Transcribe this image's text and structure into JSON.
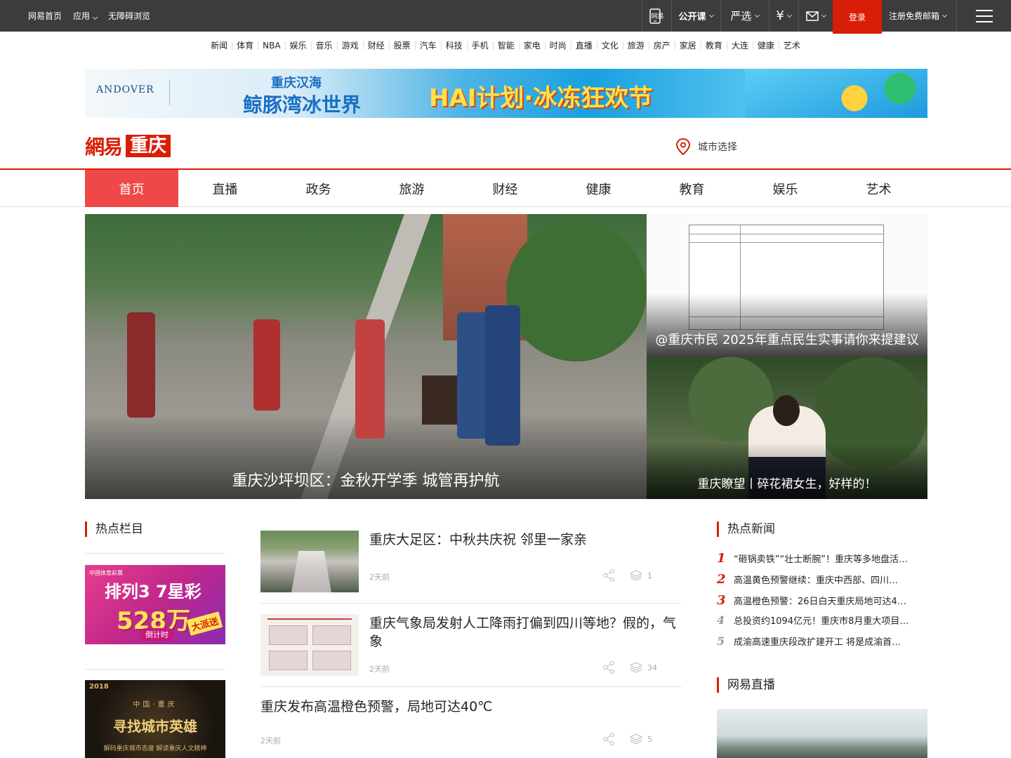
{
  "topbar": {
    "left_links": [
      "网易首页",
      "应用",
      "无障碍浏览"
    ],
    "phone_label": "网易",
    "open_course": "公开课",
    "yanxuan": "严选",
    "login": "登录",
    "register_mail": "注册免费邮箱"
  },
  "channels": [
    "新闻",
    "体育",
    "NBA",
    "娱乐",
    "音乐",
    "游戏",
    "财经",
    "股票",
    "汽车",
    "科技",
    "手机",
    "智能",
    "家电",
    "时尚",
    "直播",
    "文化",
    "旅游",
    "房产",
    "家居",
    "教育",
    "大连",
    "健康",
    "艺术"
  ],
  "banner": {
    "brand": "ANDOVER",
    "park_line1": "重庆汉海",
    "park_line2": "鲸豚湾冰世界",
    "slogan": "HAI计划·冰冻狂欢节"
  },
  "site": {
    "logo_text": "網易",
    "city_name": "重庆",
    "city_select": "城市选择"
  },
  "nav": [
    {
      "label": "首页",
      "active": true
    },
    {
      "label": "直播",
      "active": false
    },
    {
      "label": "政务",
      "active": false
    },
    {
      "label": "旅游",
      "active": false
    },
    {
      "label": "财经",
      "active": false
    },
    {
      "label": "健康",
      "active": false
    },
    {
      "label": "教育",
      "active": false
    },
    {
      "label": "娱乐",
      "active": false
    },
    {
      "label": "艺术",
      "active": false
    }
  ],
  "hero": {
    "main_caption": "重庆沙坪坝区：金秋开学季 城管再护航",
    "side1_caption": "@重庆市民 2025年重点民生实事请你来提建议",
    "side2_caption": "重庆瞭望丨碎花裙女生，好样的！"
  },
  "left_col": {
    "title": "热点栏目",
    "promo1": {
      "a": "排列3 7星彩",
      "b": "528万",
      "c": "倒计时",
      "d": "大派送",
      "e": "中国体育彩票"
    },
    "promo2": {
      "year": "2018",
      "top": "中国·重庆",
      "main": "寻找城市英雄",
      "sub": "解码重庆城市态度  解读重庆人文精神"
    }
  },
  "news": [
    {
      "title": "重庆大足区：中秋共庆祝 邻里一家亲",
      "time": "2天前",
      "comments": "1"
    },
    {
      "title": "重庆气象局发射人工降雨打偏到四川等地？假的，气象",
      "time": "2天前",
      "comments": "34"
    },
    {
      "title": "重庆发布高温橙色预警，局地可达40℃",
      "time": "2天前",
      "comments": "5"
    }
  ],
  "hot_news": {
    "title": "热点新闻",
    "items": [
      "“砸锅卖铁”“壮士断腕”！重庆等多地盘活…",
      "高温黄色预警继续：重庆中西部、四川…",
      "高温橙色预警：26日白天重庆局地可达4…",
      "总投资约1094亿元！重庆市8月重大项目…",
      "成渝高速重庆段改扩建开工 将是成渝首…"
    ],
    "ranks": [
      "1",
      "2",
      "3",
      "4",
      "5"
    ]
  },
  "live": {
    "title": "网易直播"
  },
  "colors": {
    "brand_red": "#d81e06",
    "nav_active": "#f04848",
    "topbar": "#3c3c3c"
  }
}
